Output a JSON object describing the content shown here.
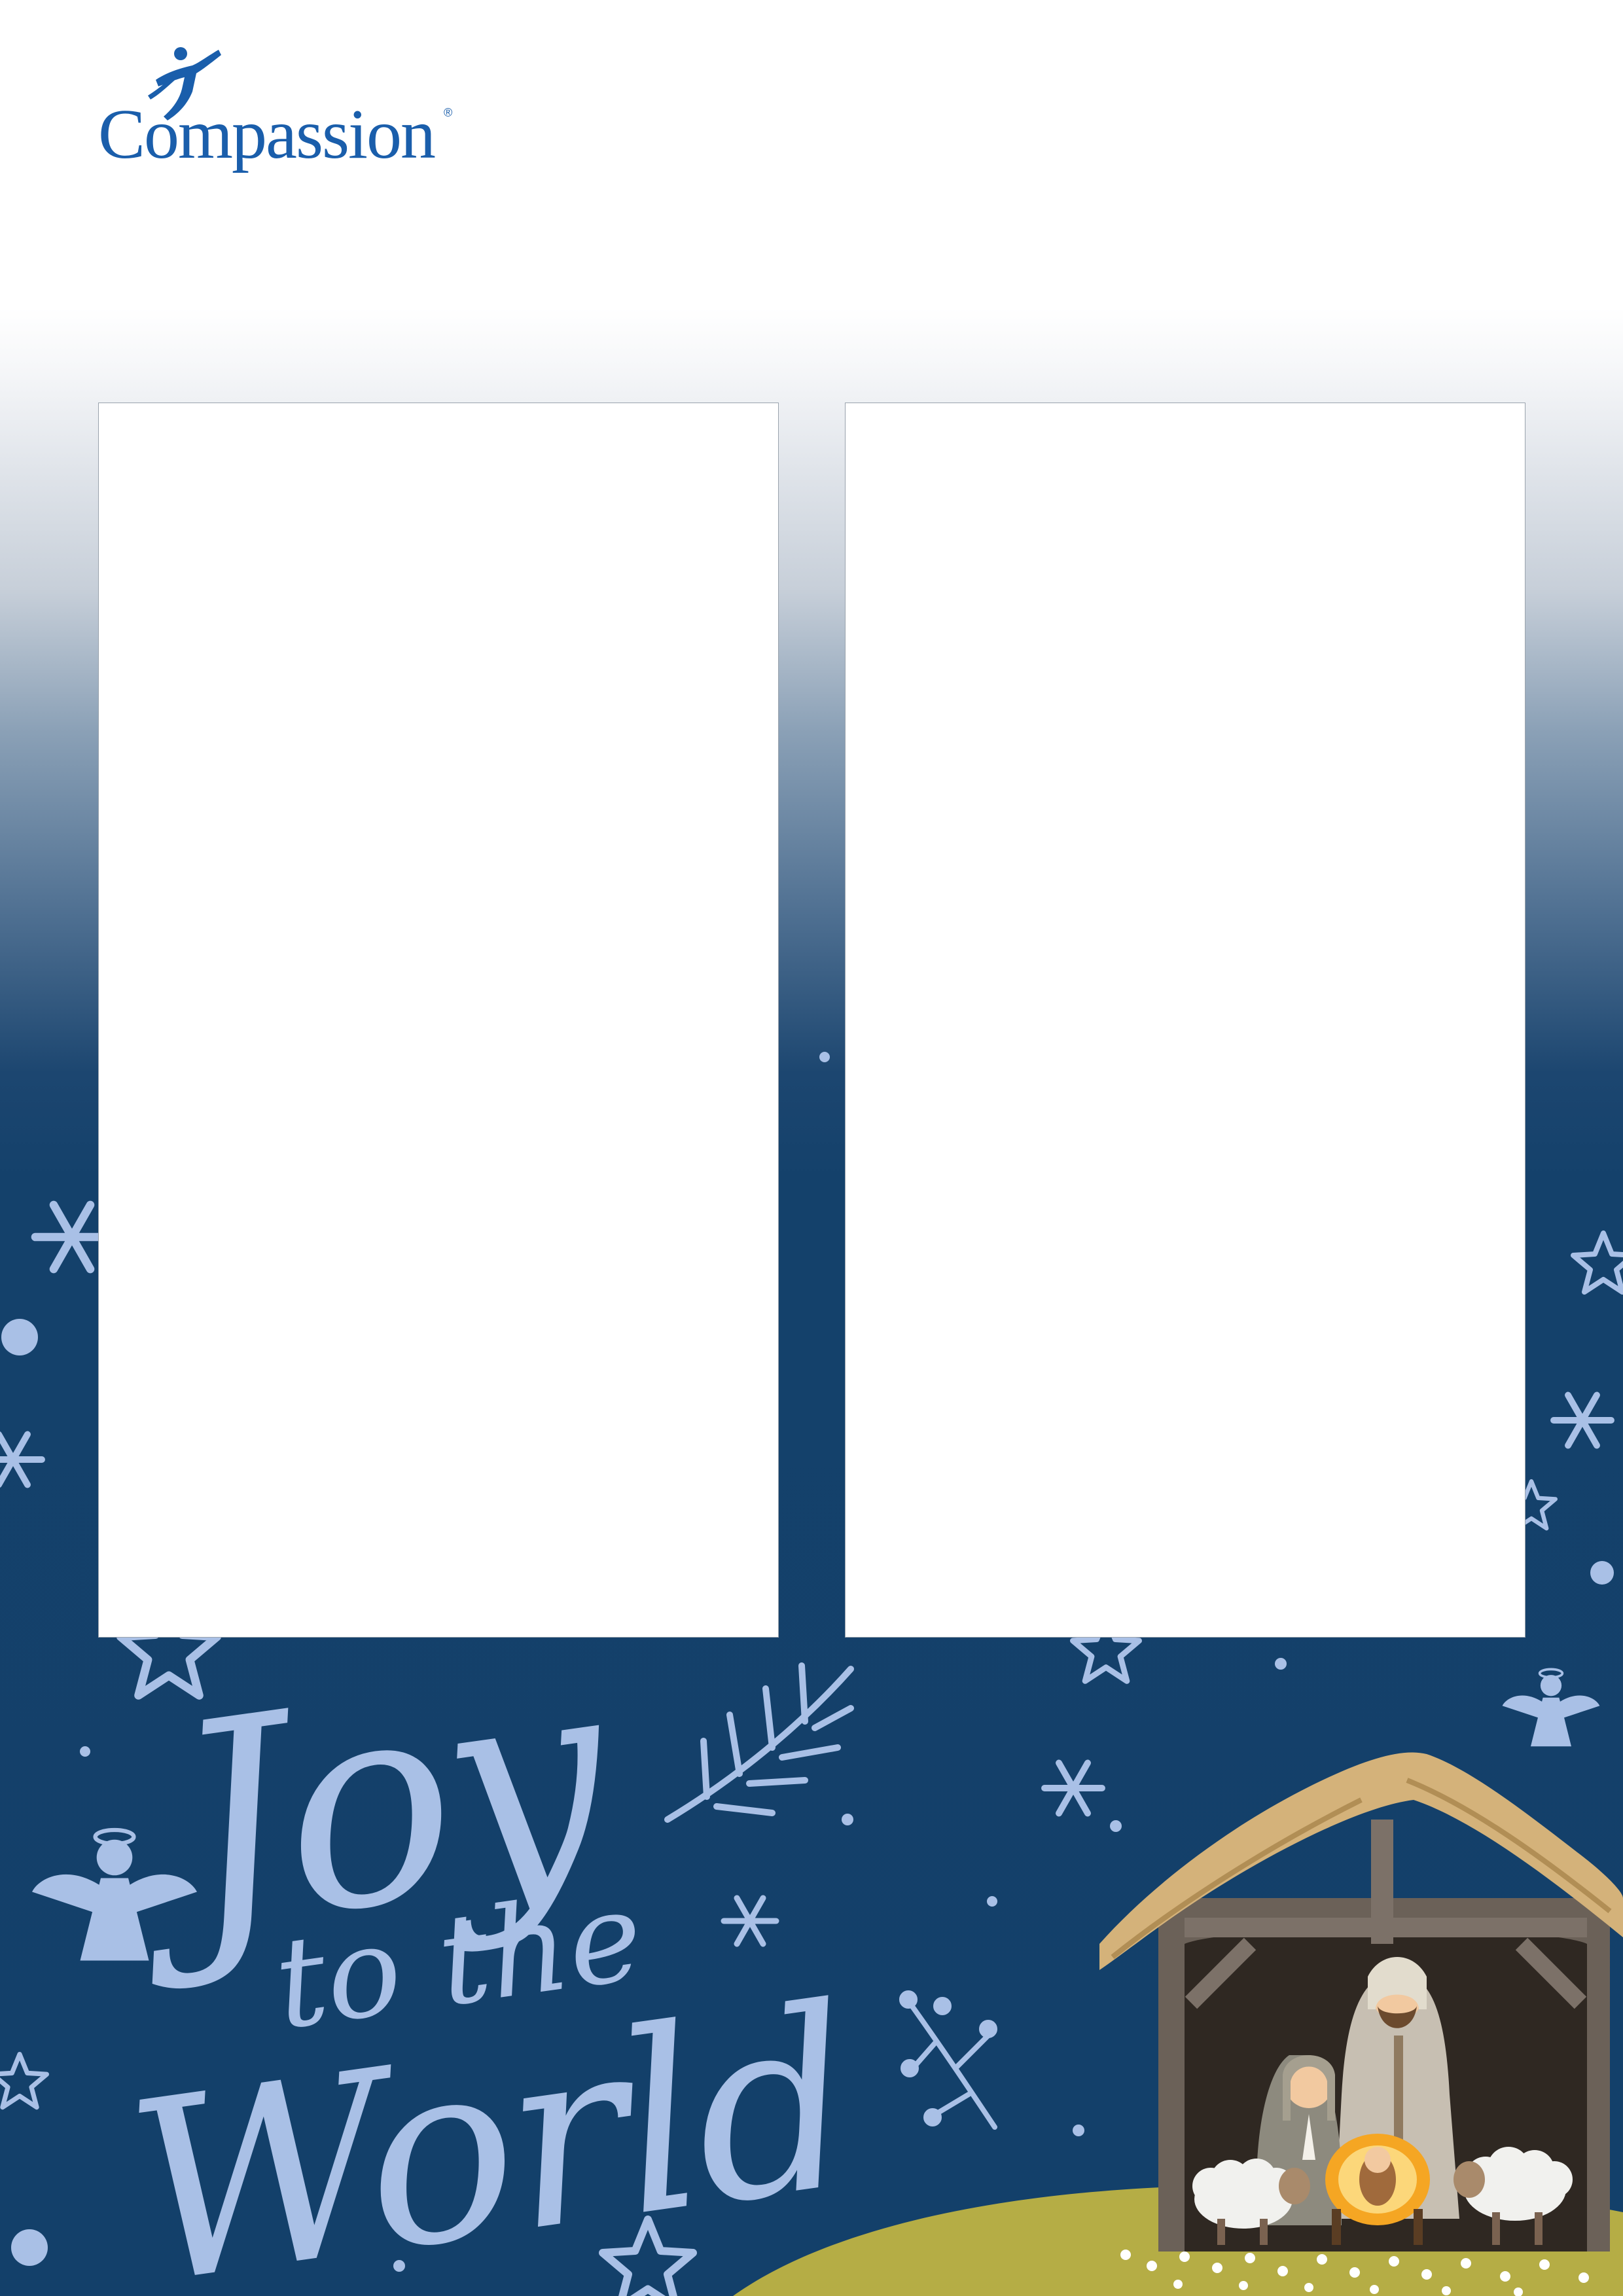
{
  "brand": {
    "name": "Compassion",
    "registered_mark": "®"
  },
  "headline": {
    "line1": "Joy",
    "line2": "to the",
    "line3": "World"
  },
  "panels": [
    {
      "id": "left-photo-frame",
      "content": ""
    },
    {
      "id": "right-photo-frame",
      "content": ""
    }
  ],
  "decorations": [
    "snowflake-icon",
    "star-icon",
    "angel-icon",
    "branch-icon",
    "dot-icon",
    "nativity-stable-illustration"
  ],
  "colors": {
    "brand_blue": "#1a5eab",
    "night_blue": "#13406a",
    "decor_light_blue": "#a9c0e6",
    "ground_olive": "#b5ad45",
    "roof_straw": "#d4b27a"
  }
}
